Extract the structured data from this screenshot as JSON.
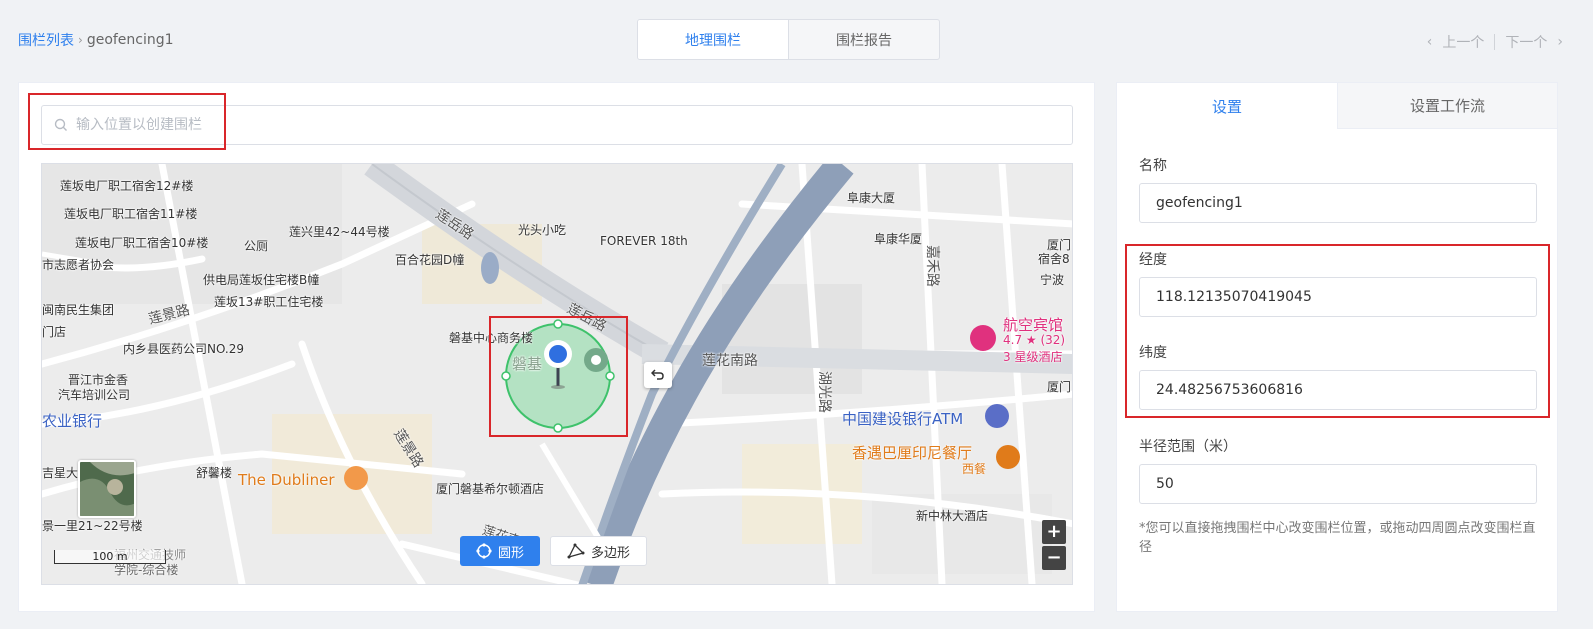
{
  "breadcrumb": {
    "root": "围栏列表",
    "current": "geofencing1"
  },
  "tabs": [
    {
      "label": "地理围栏"
    },
    {
      "label": "围栏报告"
    }
  ],
  "pager": {
    "prev": "上一个",
    "next": "下一个"
  },
  "search": {
    "placeholder": "输入位置以创建围栏"
  },
  "map": {
    "labels": {
      "l1": "莲坂电厂职工宿舍12#楼",
      "l2": "莲坂电厂职工宿舍11#楼",
      "l3": "莲坂电厂职工宿舍10#楼",
      "l4": "公厕",
      "l5": "莲兴里42~44号楼",
      "l6": "市志愿者协会",
      "l7": "百合花园D幢",
      "l8": "光头小吃",
      "l9": "FOREVER 18th",
      "l10": "阜康大厦",
      "l11": "阜康华厦",
      "l12": "供电局莲坂住宅楼B幢",
      "l13": "莲坂13#职工住宅楼",
      "l14": "闽南民生集团",
      "l15": "莲景路",
      "l16": "门店",
      "l17": "内乡县医药公司NO.29",
      "l18": "磐基中心商务楼",
      "l19": "莲岳路",
      "l20": "莲岳路",
      "l21": "莲花南路",
      "l22": "嘉禾路",
      "l23": "晋江市金香",
      "l24": "汽车培训公司",
      "l25": "农业银行",
      "l26": "湖光路",
      "l27": "中国建设银行ATM",
      "l28": "香遇巴厘印尼餐厅",
      "l29": "西餐",
      "l30": "航空宾馆",
      "l31": "4.7 ★ (32)",
      "l32": "3 星级酒店",
      "l33": "厦门",
      "l34": "宿舍8",
      "l35": "宁波",
      "l36": "厦门",
      "l37": "舒馨楼",
      "l38": "The Dubliner",
      "l39": "莲景路",
      "l40": "厦门磐基希尔顿酒店",
      "l41": "吉星大",
      "l42": "景一里21~22号楼",
      "l43": "新中林大酒店",
      "l44": "福州交通技师",
      "l45": "学院-综合楼",
      "l46": "磐基",
      "l47": "莲花南路"
    },
    "scale": "100 m",
    "shape_tools": {
      "circle": "圆形",
      "polygon": "多边形"
    },
    "zoom_in": "+",
    "zoom_out": "−"
  },
  "side": {
    "tabs": [
      {
        "label": "设置"
      },
      {
        "label": "设置工作流"
      }
    ],
    "name_label": "名称",
    "name_value": "geofencing1",
    "lng_label": "经度",
    "lng_value": "118.12135070419045",
    "lat_label": "纬度",
    "lat_value": "24.48256753606816",
    "radius_label": "半径范围（米）",
    "radius_value": "50",
    "hint": "*您可以直接拖拽围栏中心改变围栏位置，或拖动四周圆点改变围栏直径"
  },
  "colors": {
    "accent": "#2f80ed",
    "highlight": "#d9262a",
    "fence_fill": "#8fdca8",
    "fence_stroke": "#3ec26b"
  }
}
